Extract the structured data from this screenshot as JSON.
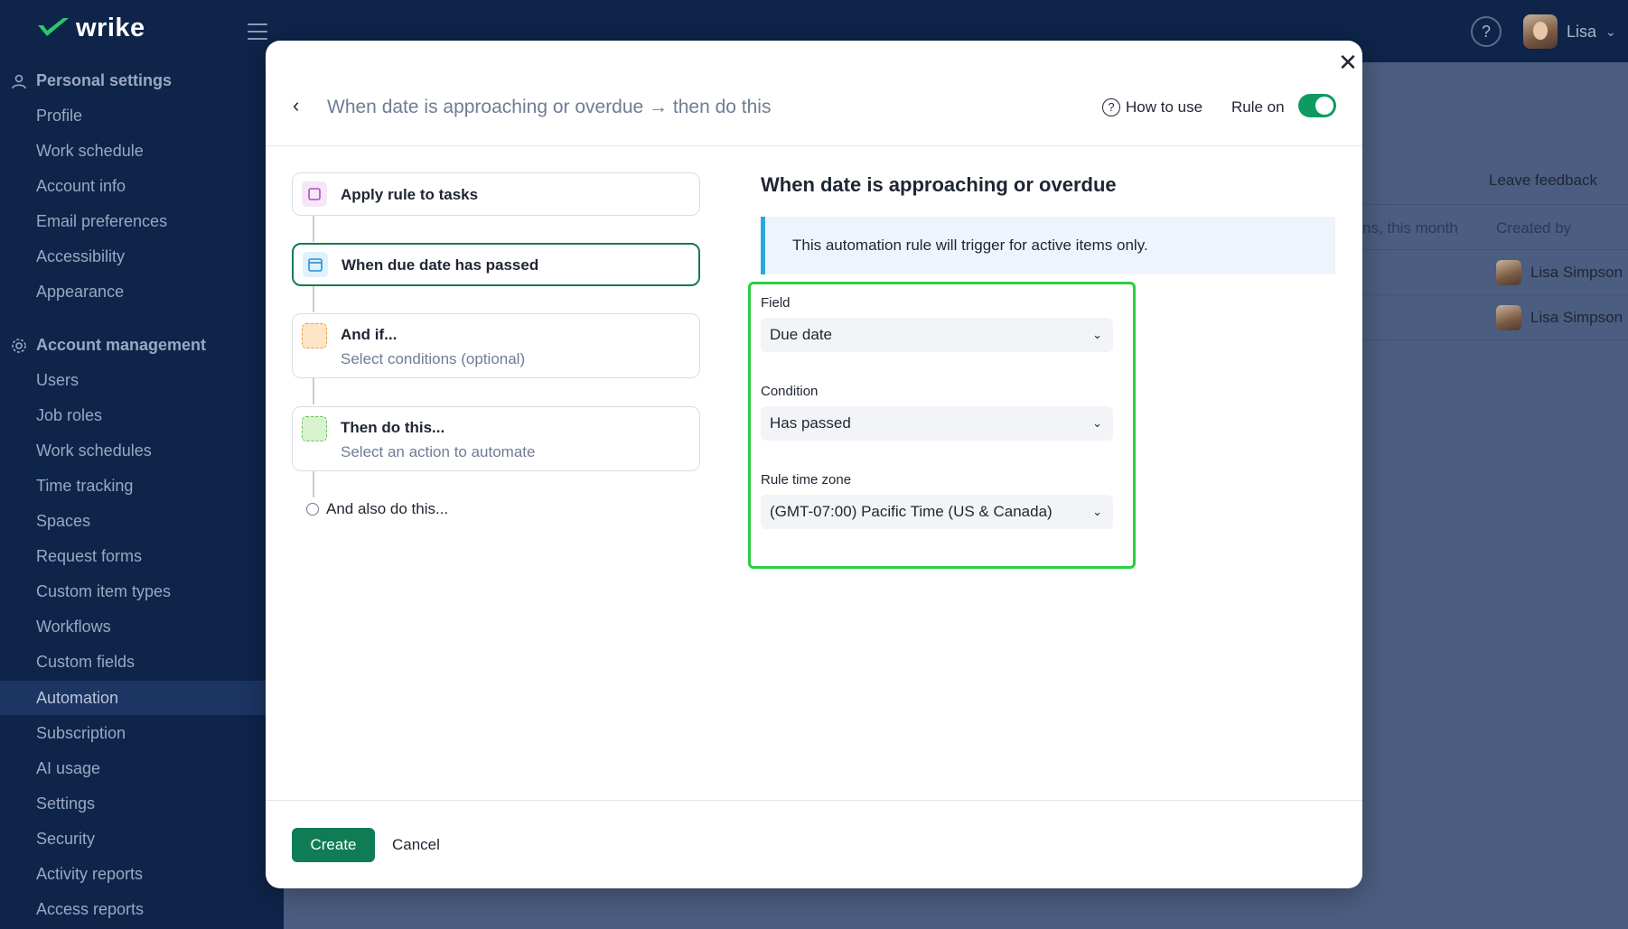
{
  "app": {
    "brand": "wrike"
  },
  "topbar": {
    "help_glyph": "?",
    "user_name": "Lisa",
    "user_chevron": "⌄"
  },
  "sidebar": {
    "personal_header": "Personal settings",
    "personal_items": [
      "Profile",
      "Work schedule",
      "Account info",
      "Email preferences",
      "Accessibility",
      "Appearance"
    ],
    "account_header": "Account management",
    "account_items": [
      "Users",
      "Job roles",
      "Work schedules",
      "Time tracking",
      "Spaces",
      "Request forms",
      "Custom item types",
      "Workflows",
      "Custom fields",
      "Automation",
      "Subscription",
      "AI usage",
      "Settings",
      "Security",
      "Activity reports",
      "Access reports"
    ],
    "active_item": "Automation"
  },
  "background_page": {
    "leave_feedback": "Leave feedback",
    "column_partial": "ns, this month",
    "column_created_by": "Created by",
    "rows": [
      "Lisa Simpson",
      "Lisa Simpson"
    ]
  },
  "modal": {
    "close_glyph": "✕",
    "back_glyph": "‹",
    "title": "When date is approaching or overdue → then do this",
    "how_to_use": "How to use",
    "rule_on_label": "Rule on",
    "rule_on": true,
    "steps": [
      {
        "title": "Apply rule to tasks",
        "subtitle": "",
        "icon": "task-icon",
        "color": "#f5e7f8"
      },
      {
        "title": "When due date has passed",
        "subtitle": "",
        "icon": "calendar-icon",
        "color": "#dff1fb"
      },
      {
        "title": "And if...",
        "subtitle": "Select conditions (optional)",
        "icon": "condition-icon",
        "color": "#fde5c6"
      },
      {
        "title": "Then do this...",
        "subtitle": "Select an action to automate",
        "icon": "action-icon",
        "color": "#d8f3d0"
      }
    ],
    "also_label": "And also do this...",
    "panel": {
      "title": "When date is approaching or overdue",
      "info": "This automation rule will trigger for active items only.",
      "field_label": "Field",
      "field_value": "Due date",
      "condition_label": "Condition",
      "condition_value": "Has passed",
      "timezone_label": "Rule time zone",
      "timezone_value": "(GMT-07:00) Pacific Time (US & Canada)"
    },
    "create_label": "Create",
    "cancel_label": "Cancel"
  },
  "colors": {
    "sidebar_bg": "#0e2449",
    "accent_green": "#0f7c55",
    "highlight": "#2bcf3f",
    "info_bar": "#2aa8e0"
  }
}
